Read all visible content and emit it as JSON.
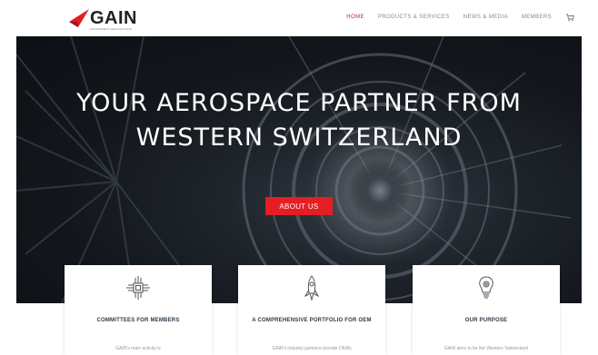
{
  "brand": {
    "name": "GAIN",
    "tagline": "GROUPEMENT AERONAUTIQUE",
    "accent_color": "#e31e24",
    "logo_icon": "red-wing-icon"
  },
  "nav": {
    "items": [
      {
        "label": "HOME",
        "active": true
      },
      {
        "label": "PRODUCTS & SERVICES",
        "active": false
      },
      {
        "label": "NEWS & MEDIA",
        "active": false
      },
      {
        "label": "MEMBERS",
        "active": false
      }
    ],
    "cart_icon": "cart-icon"
  },
  "hero": {
    "title_line1": "YOUR AEROSPACE  PARTNER FROM",
    "title_line2": "WESTERN SWITZERLAND",
    "cta_label": "ABOUT US",
    "background": "jet-engine-turbine-image"
  },
  "cards": [
    {
      "icon": "circuit-chip-icon",
      "title": "COMMITTEES FOR MEMBERS",
      "text": "GAIN's main activity is"
    },
    {
      "icon": "rocket-icon",
      "title": "A COMPREHENSIVE PORTFOLIO FOR OEM",
      "text": "GAIN's industry partners provide OEMs"
    },
    {
      "icon": "lightbulb-gear-icon",
      "title": "OUR PURPOSE",
      "text": "GAIN aims to be the Western Switzerland"
    }
  ]
}
